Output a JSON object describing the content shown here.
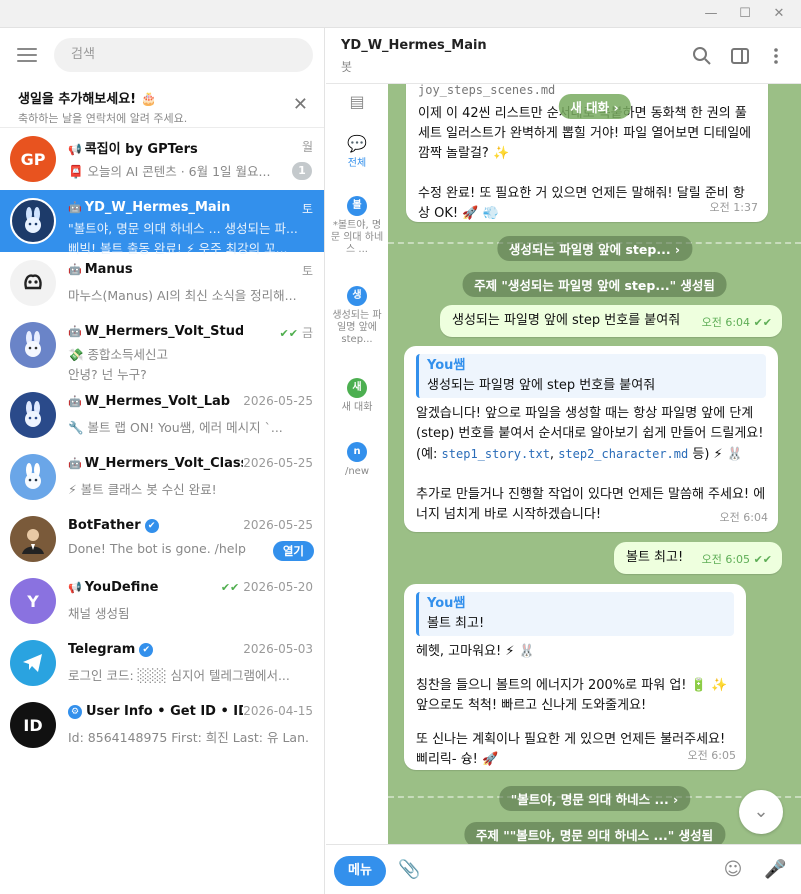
{
  "window": {
    "minimize": "—",
    "maximize": "☐",
    "close": "✕"
  },
  "left": {
    "search_placeholder": "검색",
    "promo": {
      "title": "생일을 추가해보세요! 🎂",
      "subtitle": "축하하는 날을 연락처에 알려 주세요."
    },
    "chats": [
      {
        "name": "콕집이 by GPTers",
        "date": "월",
        "preview": "오늘의 AI 콘텐츠 · 6월 1일 월요...",
        "badge": "1",
        "avatar_text": "GP",
        "avatar_color": "#e8531f"
      },
      {
        "name": "YD_W_Hermes_Main",
        "date": "토",
        "preview": "\"볼트야, 명문 의대 하네스 ... 생성되는 파... 삐빅! 볼트 출동 완료! ⚡ 우주 최강의 꼬...",
        "avatar_color": "#1d3b6a"
      },
      {
        "name": "Manus",
        "date": "토",
        "preview": "마누스(Manus) AI의 최신 소식을 정리해...",
        "avatar_color": "#f2f2f2"
      },
      {
        "name": "W_Hermers_Volt_Studio",
        "date": "금",
        "preview_line1": "💸 종합소득세신고",
        "preview_line2": "안녕? 넌 누구?",
        "avatar_color": "#6a84c8"
      },
      {
        "name": "W_Hermes_Volt_Lab",
        "date": "2026-05-25",
        "preview": "🔧 볼트 랩 ON! You쌤, 에러 메시지 `...",
        "avatar_color": "#2a4a8a"
      },
      {
        "name": "W_Hermers_Volt_Class",
        "date": "2026-05-25",
        "preview": "⚡ 볼트 클래스 봇 수신 완료!",
        "avatar_color": "#6aa6e8"
      },
      {
        "name": "BotFather",
        "date": "2026-05-25",
        "preview": "Done! The bot is gone. /help",
        "button": "열기",
        "avatar_color": "#7a5a3a"
      },
      {
        "name": "YouDefine",
        "date": "2026-05-20",
        "preview": "채널 생성됨",
        "avatar_text": "Y",
        "avatar_color": "#8a72e0"
      },
      {
        "name": "Telegram",
        "date": "2026-05-03",
        "preview": "로그인 코드: ░░░ 심지어 텔레그램에서...",
        "avatar_color": "#2aa3e0"
      },
      {
        "name": "User Info • Get ID • IDbot",
        "date": "2026-04-15",
        "preview": "Id: 8564148975 First: 희진 Last: 유 Lan...",
        "avatar_text": "ID",
        "avatar_color": "#111111"
      }
    ]
  },
  "header": {
    "title": "YD_W_Hermes_Main",
    "status": "봇"
  },
  "folders": [
    {
      "label": "",
      "icon": "▤"
    },
    {
      "label": "전체",
      "icon": "💬"
    },
    {
      "label": "*볼트야, 명문 의대 하네스 ...",
      "icon": "볼"
    },
    {
      "label": "생성되는 파일명 앞에 step...",
      "icon": "생"
    },
    {
      "label": "새 대화",
      "icon": "새"
    },
    {
      "label": "/new",
      "icon": "n"
    }
  ],
  "messages": {
    "m1_partial": "joy_steps_scenes.md",
    "m1_new_chat_pill": "새 대화 ›",
    "m1_line1": "이제 이 42씬 리스트만 순서대로 복붙하면 동화책 한 권의 풀세트 일러스트가 완벽하게 뽑힐 거야! 파일 열어보면 디테일에 깜짝 놀랄걸? ✨",
    "m1_line2": "수정 완료! 또 필요한 거 있으면 언제든 말해줘! 달릴 준비 항상 OK! 🚀 💨",
    "m1_time": "오전 1:37",
    "svc1": "생성되는 파일명 앞에 step... ›",
    "svc2": "주제 \"생성되는 파일명 앞에 step...\" 생성됨",
    "m2": "생성되는 파일명 앞에 step 번호를 붙여줘",
    "m2_time": "오전 6:04",
    "m3_reply_name": "You쌤",
    "m3_reply_text": "생성되는 파일명 앞에 step 번호를 붙여줘",
    "m3_p1a": "알겠습니다! 앞으로 파일을 생성할 때는 항상 파일명 앞에 단계(step) 번호를 붙여서 순서대로 알아보기 쉽게 만들어 드릴게요! (예: ",
    "m3_code1": "step1_story.txt",
    "m3_comma": ", ",
    "m3_code2": "step2_character.md",
    "m3_p1b": " 등) ⚡ 🐰",
    "m3_p2": "추가로 만들거나 진행할 작업이 있다면 언제든 말씀해 주세요! 에너지 넘치게 바로 시작하겠습니다!",
    "m3_time": "오전 6:04",
    "m4": "볼트 최고!",
    "m4_time": "오전 6:05",
    "m5_reply_name": "You쌤",
    "m5_reply_text": "볼트 최고!",
    "m5_p1": "헤헷, 고마워요! ⚡ 🐰",
    "m5_p2": "칭찬을 들으니 볼트의 에너지가 200%로 파워 업! 🔋 ✨ 앞으로도 척척! 빠르고 신나게 도와줄게요!",
    "m5_p3": "또 신나는 계획이나 필요한 게 있으면 언제든 불러주세요! 삐리릭- 슝! 🚀",
    "m5_time": "오전 6:05",
    "svc3": "\"볼트야, 명문 의대 하네스 ... ›",
    "svc4": "주제 \"\"볼트야, 명문 의대 하네스 ...\" 생성됨"
  },
  "composer": {
    "menu_label": "메뉴"
  },
  "colors": {
    "accent": "#3390ec",
    "out_bubble": "#eeffde",
    "chat_bg": "#9bbf86"
  }
}
